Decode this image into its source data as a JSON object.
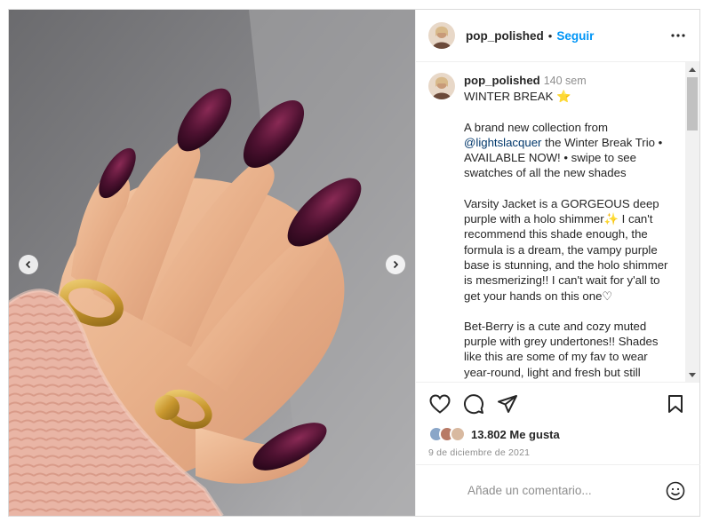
{
  "post": {
    "username": "pop_polished",
    "follow_separator": "•",
    "follow_label": "Seguir",
    "more_icon": "more-horizontal-icon",
    "caption": {
      "username": "pop_polished",
      "time": "140 sem",
      "title": "WINTER BREAK",
      "title_emoji": "⭐",
      "para1_prefix": "A brand new collection from ",
      "mention": "@lightslacquer",
      "para1_suffix": " the Winter Break Trio • AVAILABLE NOW! • swipe to see swatches of all the new shades",
      "para2": "Varsity Jacket is a GORGEOUS deep purple with a holo shimmer✨ I can't recommend this shade enough, the formula is a dream, the vampy purple base is stunning, and the holo shimmer is mesmerizing!! I can't wait for y'all to get your hands on this one♡",
      "para3": "Bet-Berry is a cute and cozy muted purple with grey undertones!! Shades like this are some of my fav to wear year-round, light and fresh but still"
    },
    "likes_count": "13.802",
    "likes_label": "Me gusta",
    "date": "9 de diciembre de 2021",
    "comment_placeholder": "Añade un comentario...",
    "icons": {
      "like": "heart-icon",
      "comment": "comment-icon",
      "share": "share-icon",
      "save": "bookmark-icon",
      "emoji": "emoji-icon",
      "prev": "chevron-left-icon",
      "next": "chevron-right-icon"
    },
    "colors": {
      "follow": "#0095f6",
      "mention": "#00376b",
      "muted": "#8e8e8e",
      "nail_polish": "#4a0f2a"
    }
  }
}
